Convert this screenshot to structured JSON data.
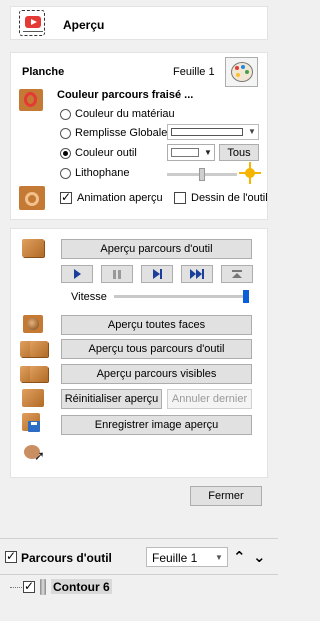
{
  "header": {
    "title": "Aperçu",
    "icon": "preview-play-icon"
  },
  "planche": {
    "section_label": "Planche",
    "sheet_label": "Feuille 1",
    "color_title": "Couleur parcours fraisé ...",
    "options": [
      {
        "label": "Couleur du matériau",
        "selected": false
      },
      {
        "label": "Remplisse Globale",
        "selected": false
      },
      {
        "label": "Couleur outil",
        "selected": true
      },
      {
        "label": "Lithophane",
        "selected": false
      }
    ],
    "tous_label": "Tous",
    "animation_label": "Animation aperçu",
    "animation_checked": true,
    "dessin_label": "Dessin de l'outil",
    "dessin_checked": false
  },
  "preview": {
    "preview_toolpath_label": "Aperçu parcours d'outil",
    "speed_label": "Vitesse",
    "speed_level": 1.0,
    "all_faces_label": "Aperçu toutes faces",
    "all_toolpaths_label": "Aperçu tous parcours d'outil",
    "visible_toolpaths_label": "Aperçu parcours visibles",
    "reset_label": "Réinitialiser aperçu",
    "undo_label": "Annuler dernier",
    "save_image_label": "Enregistrer image aperçu"
  },
  "footer": {
    "close_label": "Fermer"
  },
  "toolpaths": {
    "title": "Parcours d'outil",
    "title_checked": true,
    "sheet_select": "Feuille 1",
    "items": [
      {
        "label": "Contour 6",
        "checked": true
      }
    ]
  },
  "colors": {
    "accent_blue": "#1a3f9a",
    "slider_thumb": "#0a5fd8",
    "sun": "#f4b400",
    "wood": "#c47a35"
  }
}
